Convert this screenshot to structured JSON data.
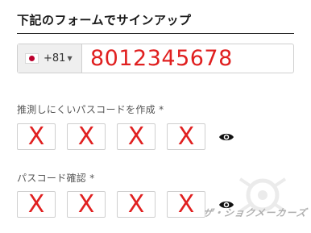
{
  "form": {
    "title": "下記のフォームでサインアップ"
  },
  "phone": {
    "country_code": "+81",
    "number": "8012345678"
  },
  "pin_create": {
    "label": "推測しにくいパスコードを作成 *",
    "digits": [
      "X",
      "X",
      "X",
      "X"
    ]
  },
  "pin_confirm": {
    "label": "パスコード確認 *",
    "digits": [
      "X",
      "X",
      "X",
      "X"
    ]
  },
  "watermark": {
    "text": "ザ・ショクメーカーズ"
  },
  "icons": {
    "flag": "japan-flag-icon",
    "caret": "caret-down-icon",
    "eye": "eye-icon"
  },
  "colors": {
    "accent_red": "#e02020"
  }
}
